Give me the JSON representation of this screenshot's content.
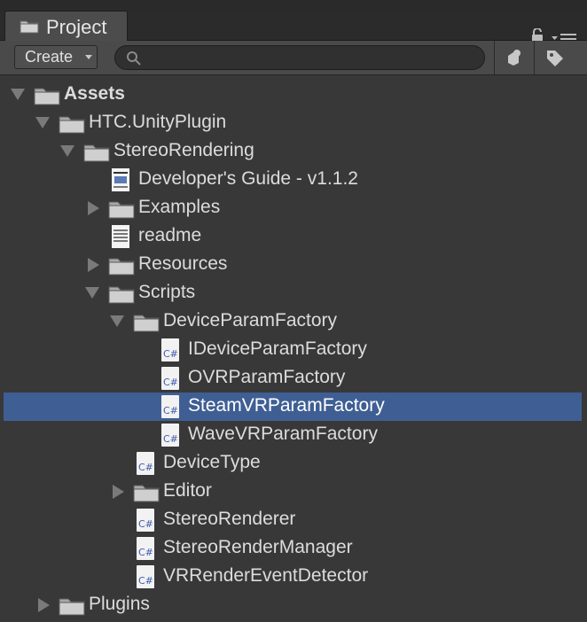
{
  "tab": {
    "label": "Project",
    "icon": "folder-icon"
  },
  "toolbar": {
    "create_label": "Create",
    "search_placeholder": ""
  },
  "tree": {
    "assets": "Assets",
    "htc_plugin": "HTC.UnityPlugin",
    "stereo_rendering": "StereoRendering",
    "developers_guide": "Developer's Guide - v1.1.2",
    "examples": "Examples",
    "readme": "readme",
    "resources": "Resources",
    "scripts": "Scripts",
    "device_param_factory": "DeviceParamFactory",
    "i_device_param_factory": "IDeviceParamFactory",
    "ovr_param_factory": "OVRParamFactory",
    "steamvr_param_factory": "SteamVRParamFactory",
    "wavevr_param_factory": "WaveVRParamFactory",
    "device_type": "DeviceType",
    "editor": "Editor",
    "stereo_renderer": "StereoRenderer",
    "stereo_render_manager": "StereoRenderManager",
    "vr_render_event_detector": "VRRenderEventDetector",
    "plugins": "Plugins"
  },
  "csharp_badge": "C#",
  "colors": {
    "background": "#383838",
    "selection": "#3f5f94",
    "text": "#dcdcdc",
    "csharp": "#3f5bb0"
  }
}
